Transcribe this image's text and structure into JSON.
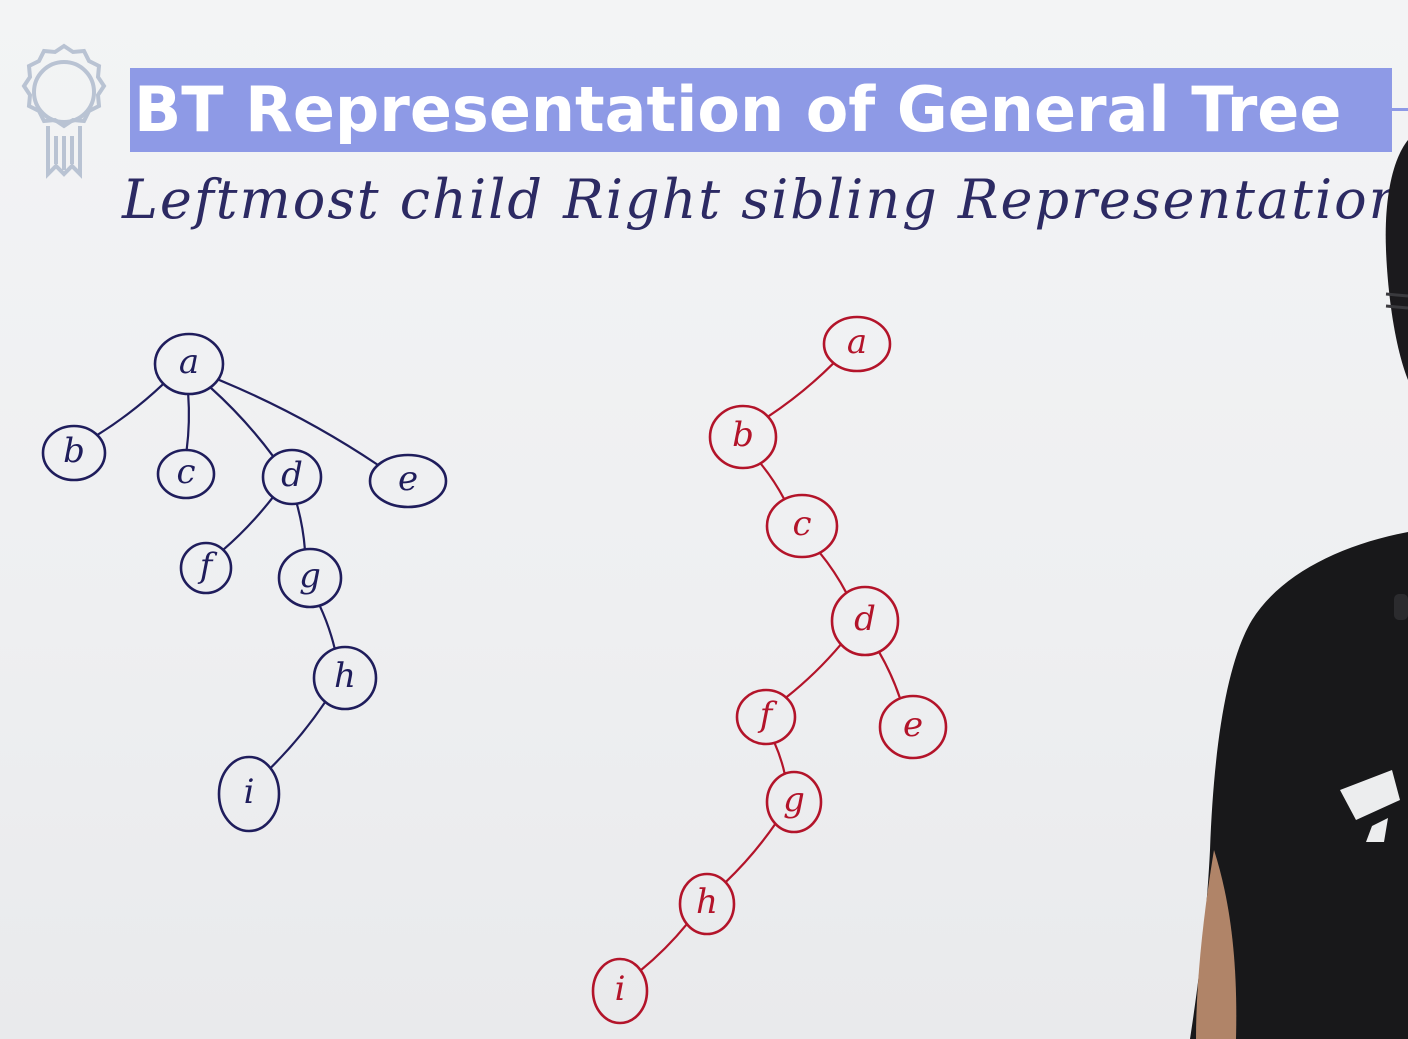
{
  "title": "BT Representation of General Tree",
  "subtitle": "Leftmost child Right sibling Representation",
  "colors": {
    "title_bar": "#8e9ae6",
    "general_tree_ink": "#1f1d5c",
    "binary_tree_ink": "#b3142a",
    "subtitle_ink": "#2c2a63"
  },
  "general_tree": {
    "nodes": [
      {
        "id": "a",
        "label": "a"
      },
      {
        "id": "b",
        "label": "b"
      },
      {
        "id": "c",
        "label": "c"
      },
      {
        "id": "d",
        "label": "d"
      },
      {
        "id": "e",
        "label": "e"
      },
      {
        "id": "f",
        "label": "f"
      },
      {
        "id": "g",
        "label": "g"
      },
      {
        "id": "h",
        "label": "h"
      },
      {
        "id": "i",
        "label": "i"
      }
    ],
    "edges": [
      [
        "a",
        "b"
      ],
      [
        "a",
        "c"
      ],
      [
        "a",
        "d"
      ],
      [
        "a",
        "e"
      ],
      [
        "d",
        "f"
      ],
      [
        "d",
        "g"
      ],
      [
        "g",
        "h"
      ],
      [
        "h",
        "i"
      ]
    ]
  },
  "binary_tree": {
    "nodes": [
      {
        "id": "a",
        "label": "a"
      },
      {
        "id": "b",
        "label": "b"
      },
      {
        "id": "c",
        "label": "c"
      },
      {
        "id": "d",
        "label": "d"
      },
      {
        "id": "f",
        "label": "f"
      },
      {
        "id": "e",
        "label": "e"
      },
      {
        "id": "g",
        "label": "g"
      },
      {
        "id": "h",
        "label": "h"
      },
      {
        "id": "i",
        "label": "i"
      }
    ],
    "edges": [
      [
        "a",
        "b"
      ],
      [
        "b",
        "c"
      ],
      [
        "c",
        "d"
      ],
      [
        "d",
        "f"
      ],
      [
        "d",
        "e"
      ],
      [
        "f",
        "g"
      ],
      [
        "g",
        "h"
      ],
      [
        "h",
        "i"
      ]
    ]
  }
}
